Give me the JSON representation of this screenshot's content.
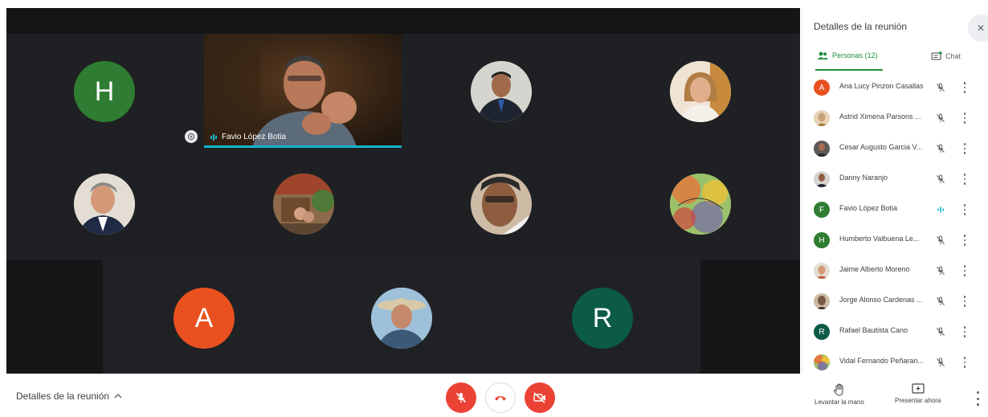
{
  "grid": {
    "tiles": [
      {
        "letter": "H",
        "color": "#2e7d32"
      },
      {
        "letter": "A",
        "color": "#e8511f"
      },
      {
        "letter": "R",
        "color": "#0b5b46"
      }
    ],
    "speaker": {
      "name": "Favio López Botia"
    }
  },
  "bottom_bar": {
    "details_label": "Detalles de la reunión",
    "actions": {
      "raise_hand": "Levantar la mano",
      "present": "Presentar ahora"
    }
  },
  "panel": {
    "title": "Detalles de la reunión",
    "tabs": {
      "people": "Personas (12)",
      "chat": "Chat"
    },
    "people": [
      {
        "name": "Ana Lucy Pinzon Casallas",
        "initial": "A",
        "avatar_color": "#e8511f",
        "speaking": false
      },
      {
        "name": "Astrid Ximena Parsons ...",
        "initial": "",
        "avatar_color": "#c8a27a",
        "speaking": false
      },
      {
        "name": "Cesar Augusto Garcia V...",
        "initial": "",
        "avatar_color": "#4a4a4a",
        "speaking": false
      },
      {
        "name": "Danny Naranjo",
        "initial": "",
        "avatar_color": "#6b5440",
        "speaking": false
      },
      {
        "name": "Favio López Botia",
        "initial": "F",
        "avatar_color": "#2e7d32",
        "speaking": true
      },
      {
        "name": "Humberto Valbuena Le...",
        "initial": "H",
        "avatar_color": "#2e7d32",
        "speaking": false
      },
      {
        "name": "Jaime Alberto Moreno",
        "initial": "",
        "avatar_color": "#b98a6a",
        "speaking": false
      },
      {
        "name": "Jorge Alonso Cardenas ...",
        "initial": "",
        "avatar_color": "#7a5a44",
        "speaking": false
      },
      {
        "name": "Rafael Bautista Cano",
        "initial": "R",
        "avatar_color": "#0b5b46",
        "speaking": false
      },
      {
        "name": "Vidal Fernando Peñaran...",
        "initial": "",
        "avatar_color": "#c79a2c",
        "speaking": false
      }
    ]
  },
  "colors": {
    "accent_green": "#1e8e3e",
    "speaking_teal": "#12b5cb",
    "danger_red": "#ea4335"
  }
}
